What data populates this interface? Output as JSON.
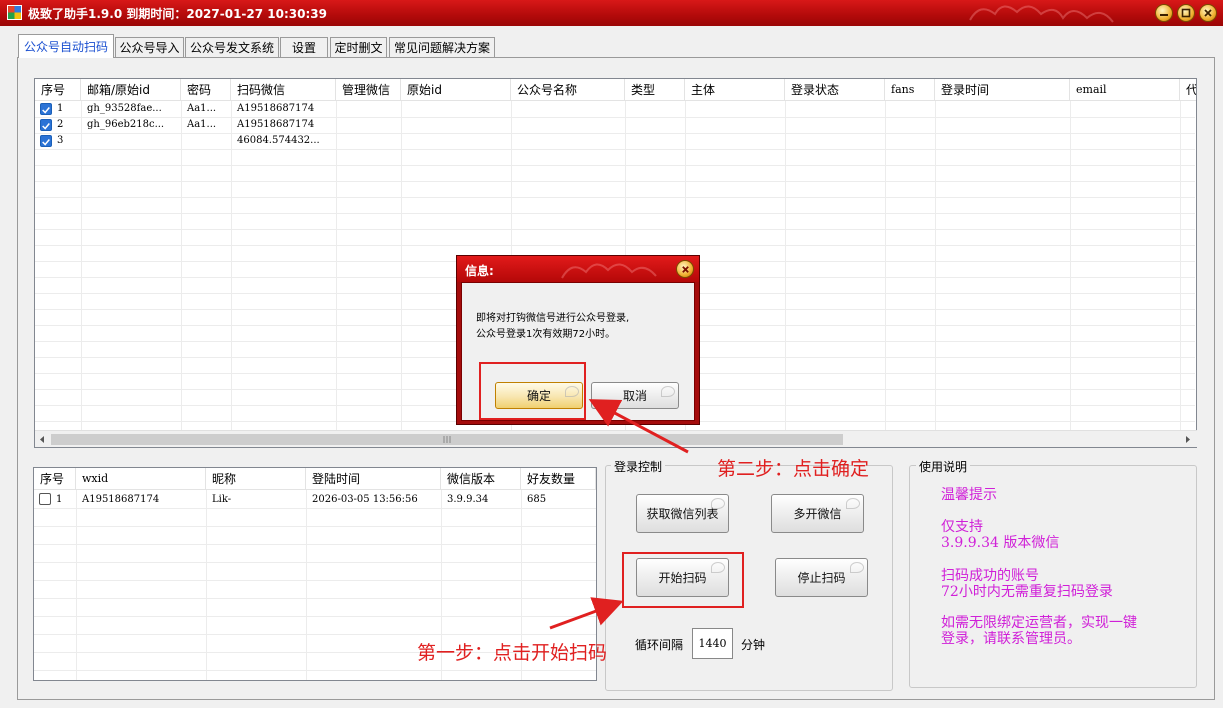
{
  "window": {
    "title": "极致了助手1.9.0  到期时间：2027-01-27 10:30:39"
  },
  "tabs": [
    {
      "label": "公众号自动扫码"
    },
    {
      "label": "公众号导入"
    },
    {
      "label": "公众号发文系统"
    },
    {
      "label": "设置"
    },
    {
      "label": "定时删文"
    },
    {
      "label": "常见问题解决方案"
    }
  ],
  "accounts_table": {
    "columns": [
      "序号",
      "邮箱/原始id",
      "密码",
      "扫码微信",
      "管理微信",
      "原始id",
      "公众号名称",
      "类型",
      "主体",
      "登录状态",
      "fans",
      "登录时间",
      "email",
      "代"
    ],
    "rows": [
      {
        "checked": true,
        "index": "1",
        "email": "gh_93528fae...",
        "password": "Aa1...",
        "scan_wechat": "A19518687174"
      },
      {
        "checked": true,
        "index": "2",
        "email": "gh_96eb218c...",
        "password": "Aa1...",
        "scan_wechat": "A19518687174"
      },
      {
        "checked": true,
        "index": "3",
        "email": "",
        "password": "",
        "scan_wechat": "46084.574432..."
      }
    ]
  },
  "wechat_table": {
    "columns": [
      "序号",
      "wxid",
      "昵称",
      "登陆时间",
      "微信版本",
      "好友数量"
    ],
    "rows": [
      {
        "checked": false,
        "index": "1",
        "wxid": "A19518687174",
        "nickname": "Lik-",
        "login_time": "2026-03-05 13:56:56",
        "version": "3.9.9.34",
        "friends": "685"
      }
    ]
  },
  "login_control": {
    "label": "登录控制",
    "get_list": "获取微信列表",
    "multi_open": "多开微信",
    "start_scan": "开始扫码",
    "stop_scan": "停止扫码",
    "interval_label": "循环间隔",
    "interval_value": "1440",
    "interval_unit": "分钟"
  },
  "instructions": {
    "label": "使用说明",
    "tip_title": "温馨提示",
    "support": "仅支持\n3.9.9.34 版本微信",
    "scan_success": "扫码成功的账号\n72小时内无需重复扫码登录",
    "unlimited": "如需无限绑定运营者，实现一键\n登录，请联系管理员。"
  },
  "dialog": {
    "title": "信息:",
    "message": "即将对打钩微信号进行公众号登录,\n公众号登录1次有效期72小时。",
    "ok": "确定",
    "cancel": "取消"
  },
  "annotations": {
    "step1": "第一步：点击开始扫码",
    "step2": "第二步：点击确定"
  },
  "colors": {
    "title_red": "#c01010",
    "help_magenta": "#d020d8",
    "annotation_red": "#e02020"
  }
}
